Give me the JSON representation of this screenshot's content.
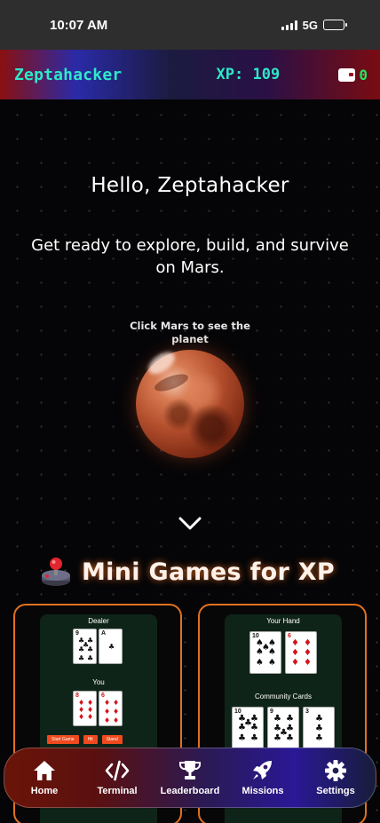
{
  "status_bar": {
    "time": "10:07 AM",
    "network": "5G"
  },
  "header": {
    "username": "Zeptahacker",
    "xp_label": "XP: 109",
    "wallet_value": "0"
  },
  "hero": {
    "greeting": "Hello, Zeptahacker",
    "tagline": "Get ready to explore, build, and survive on Mars.",
    "mars_hint": "Click Mars to see the planet"
  },
  "section": {
    "title": "Mini Games for XP"
  },
  "games": {
    "blackjack": {
      "dealer_label": "Dealer",
      "you_label": "You",
      "buttons": [
        "Start Game",
        "Hit",
        "Stand"
      ]
    },
    "poker": {
      "hand_label": "Your Hand",
      "community_label": "Community Cards"
    }
  },
  "nav": {
    "items": [
      {
        "label": "Home",
        "icon": "home-icon"
      },
      {
        "label": "Terminal",
        "icon": "code-icon"
      },
      {
        "label": "Leaderboard",
        "icon": "trophy-icon"
      },
      {
        "label": "Missions",
        "icon": "rocket-icon"
      },
      {
        "label": "Settings",
        "icon": "gear-icon"
      }
    ]
  },
  "colors": {
    "accent": "#2ee8c8",
    "wallet": "#22e860",
    "card_border": "#e0711f",
    "button": "#ef4a1e"
  }
}
